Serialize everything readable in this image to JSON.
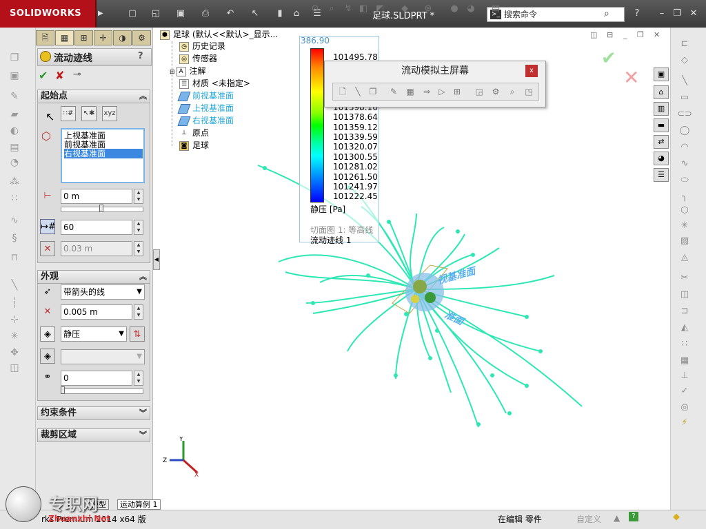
{
  "app": {
    "logo_text": "SOLIDWORKS",
    "doc_title": "足球.SLDPRT *",
    "search_placeholder": "搜索命令",
    "quick_icons": [
      "new-icon",
      "open-icon",
      "save-icon",
      "print-icon",
      "undo-icon",
      "select-icon",
      "rebuild-icon",
      "file-props-icon",
      "options-icon"
    ]
  },
  "property_manager": {
    "tabs": [
      "feature-tree-icon",
      "property-icon",
      "config-icon",
      "dimxpert-icon",
      "display-icon",
      "flow-icon"
    ],
    "title": "流动迹线",
    "help": "?",
    "start_points": {
      "header": "起始点",
      "planes": [
        "上视基准面",
        "前视基准面",
        "右视基准面"
      ],
      "selected_index": 2,
      "offset_value": "0 m",
      "count_value": "60",
      "spacing_value": "0.03 m"
    },
    "appearance": {
      "header": "外观",
      "draw_as": "带箭头的线",
      "width_value": "0.005 m",
      "color_by": "静压",
      "second_combo": "",
      "transparency_value": "0"
    },
    "constraints_header": "约束条件",
    "clipping_header": "裁剪区域"
  },
  "tree": {
    "root": "足球 (默认<<默认>_显示...",
    "items": [
      {
        "label": "历史记录",
        "icon": "history-icon"
      },
      {
        "label": "传感器",
        "icon": "sensor-icon"
      },
      {
        "label": "注解",
        "icon": "annotation-icon"
      },
      {
        "label": "材质 <未指定>",
        "icon": "material-icon"
      },
      {
        "label": "前视基准面",
        "icon": "plane-icon"
      },
      {
        "label": "上视基准面",
        "icon": "plane-icon"
      },
      {
        "label": "右视基准面",
        "icon": "plane-icon"
      },
      {
        "label": "原点",
        "icon": "origin-icon"
      },
      {
        "label": "足球",
        "icon": "part-icon"
      }
    ]
  },
  "legend": {
    "top_label": "386.90",
    "values": [
      "101495.78",
      "101398.16",
      "101378.64",
      "101359.12",
      "101339.59",
      "101320.07",
      "101300.55",
      "101281.02",
      "101261.50",
      "101241.97",
      "101222.45"
    ],
    "unit_label": "静压 [Pa]",
    "cut_plot": "切面图 1: 等高线",
    "flow_traj": "流动迹线 1"
  },
  "flow_dialog": {
    "title": "流动模拟主屏幕",
    "close": "x"
  },
  "status": {
    "left": "rks Premium 2014 x64 版",
    "editing": "在编辑 零件",
    "custom": "自定义",
    "tabs": [
      "模型",
      "运动算例 1"
    ]
  },
  "watermark": {
    "main": "专职网",
    "sub": "Zhuanzhi Net"
  },
  "colors": {
    "accent": "#b4101a",
    "streamline": "#2de8b4",
    "plane_label": "#22a8d8"
  }
}
